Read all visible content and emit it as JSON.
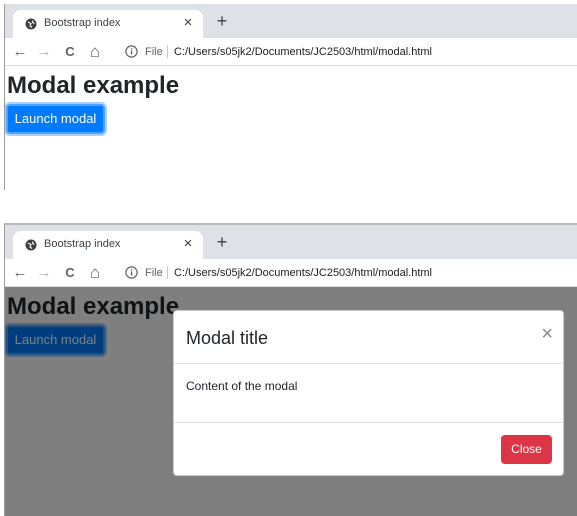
{
  "browser": {
    "tab_title": "Bootstrap index",
    "tab_close": "×",
    "new_tab": "+",
    "nav": {
      "back": "←",
      "forward": "→",
      "reload": "C",
      "home": "⌂"
    },
    "file_label": "File",
    "url": "C:/Users/s05jk2/Documents/JC2503/html/modal.html"
  },
  "page": {
    "heading": "Modal example",
    "launch_button": "Launch modal"
  },
  "modal": {
    "title": "Modal title",
    "close_x": "×",
    "body": "Content of the modal",
    "close_button": "Close"
  },
  "colors": {
    "primary": "#007bff",
    "danger": "#dc3545",
    "tabstrip": "#dee1e6"
  }
}
